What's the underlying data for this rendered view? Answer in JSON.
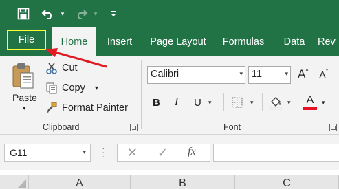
{
  "colors": {
    "excel_green": "#217346",
    "file_highlight": "#ffff33",
    "annotation_arrow": "#e01b24",
    "font_color_bar": "#e81123"
  },
  "qat": {
    "save_icon": "save-icon",
    "undo_icon": "undo-icon",
    "redo_icon": "redo-icon",
    "customize_icon": "customize-toolbar-icon"
  },
  "tabs": [
    {
      "label": "File"
    },
    {
      "label": "Home"
    },
    {
      "label": "Insert"
    },
    {
      "label": "Page Layout"
    },
    {
      "label": "Formulas"
    },
    {
      "label": "Data"
    },
    {
      "label": "Rev"
    }
  ],
  "clipboard": {
    "paste_label": "Paste",
    "cut_label": "Cut",
    "copy_label": "Copy",
    "format_painter_label": "Format Painter",
    "group_label": "Clipboard"
  },
  "font": {
    "font_name": "Calibri",
    "font_size": "11",
    "bold": "B",
    "italic": "I",
    "underline": "U",
    "font_color_letter": "A",
    "grow_letter": "A",
    "shrink_letter": "A",
    "group_label": "Font"
  },
  "formula_bar": {
    "name_box": "G11",
    "insert_function": "fx",
    "cancel_glyph": "✕",
    "enter_glyph": "✓"
  },
  "columns": [
    "A",
    "B",
    "C"
  ]
}
